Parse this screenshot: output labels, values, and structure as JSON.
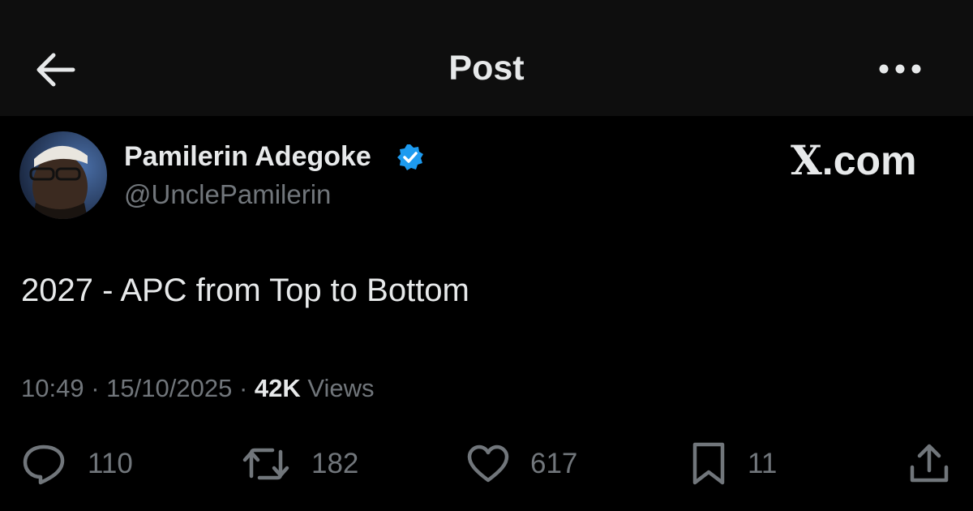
{
  "header": {
    "title": "Post",
    "back_icon": "arrow-left-icon",
    "more_icon": "more-horizontal-icon"
  },
  "author": {
    "name": "Pamilerin Adegoke",
    "handle": "@UnclePamilerin",
    "verified_icon": "verified-badge-icon",
    "verified_color": "#1d9bf0"
  },
  "watermark": {
    "x_letter": "X",
    "suffix": ".com"
  },
  "post": {
    "text": "2027 - APC from Top to Bottom",
    "time": "10:49",
    "separator": "·",
    "date": "15/10/2025",
    "views_count": "42K",
    "views_label": "Views"
  },
  "actions": {
    "replies": "110",
    "reposts": "182",
    "likes": "617",
    "bookmarks": "11"
  },
  "colors": {
    "background": "#000000",
    "header_background": "#0e0e0e",
    "primary_text": "#e7e9ea",
    "secondary_text": "#71767b"
  }
}
